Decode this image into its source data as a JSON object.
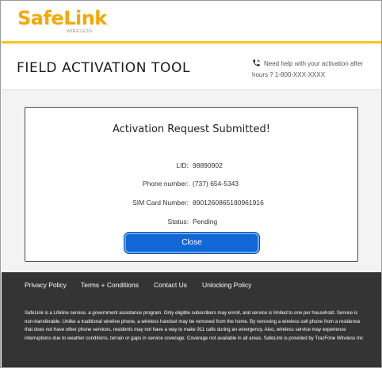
{
  "brand": {
    "logo_text": "SafeLink",
    "logo_sub": "WIRELESS",
    "accent_color": "#f5a800"
  },
  "header": {
    "title": "FIELD ACTIVATION TOOL",
    "help_line1": "Need help with your activation after",
    "help_line2": "hours ? 1-800-XXX-XXXX"
  },
  "dialog": {
    "title": "Activation Request Submitted!",
    "rows": [
      {
        "label": "LID:",
        "value": "98890902"
      },
      {
        "label": "Phone number:",
        "value": "(737) 654-5343"
      },
      {
        "label": "SIM Card Number:",
        "value": "8901260865180961916"
      },
      {
        "label": "Status:",
        "value": "Pending"
      }
    ],
    "close_label": "Close",
    "button_color": "#1267d6"
  },
  "footer": {
    "links": [
      "Privacy Policy",
      "Terms + Conditions",
      "Contact Us",
      "Unlocking Policy"
    ],
    "disclaimer": "SafeLink is a Lifeline service, a government assistance program. Only eligible subscribers may enroll, and service is limited to one per household. Service is non-transferable. Unlike a traditional wireline phone, a wireless handset may be removed from the home. By removing a wireless cell phone from a residence that does not have other phone services, residents may not have a way to make 911 calls during an emergency. Also, wireless service may experience interruptions due to weather conditions, terrain or gaps in service coverage. Coverage not available in all areas. SafeLink is provided by TracFone Wireless Inc"
  }
}
